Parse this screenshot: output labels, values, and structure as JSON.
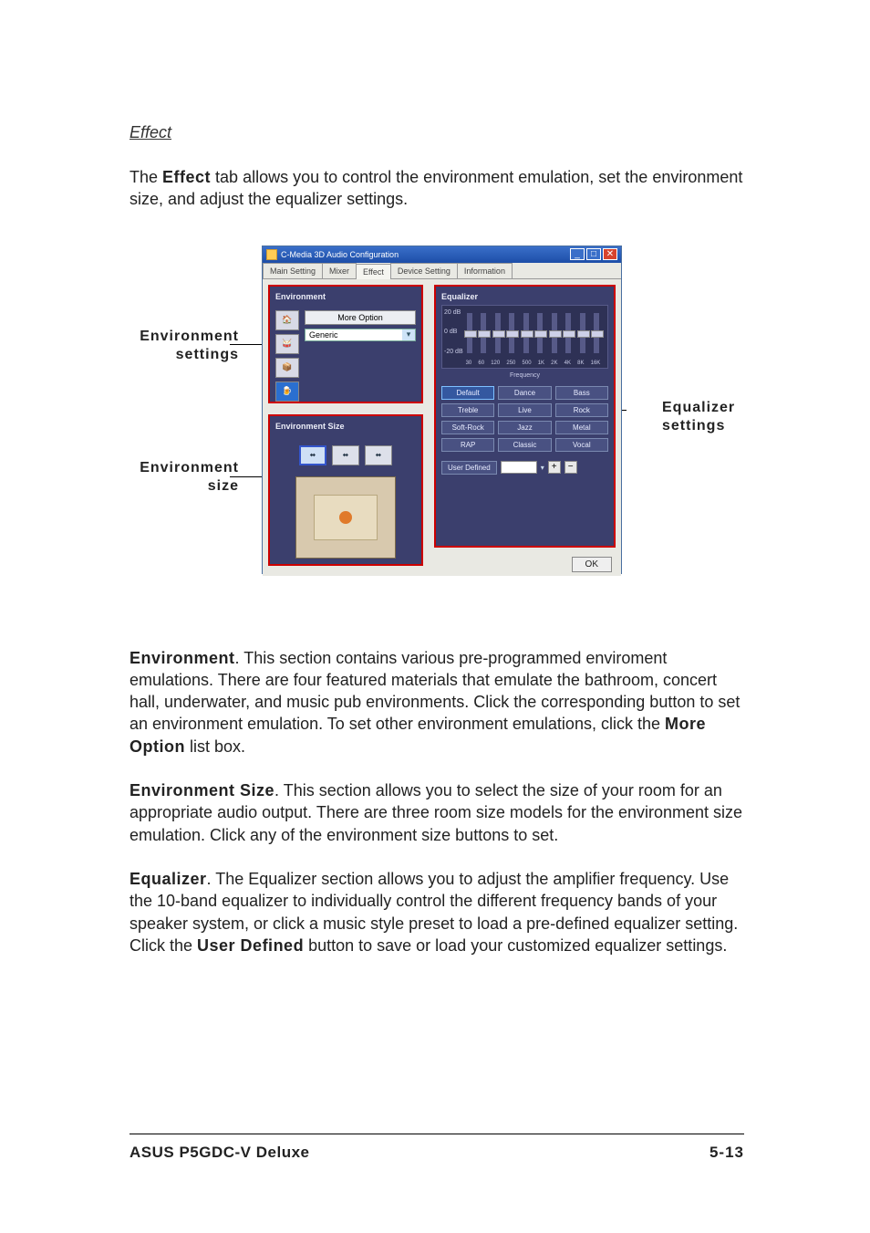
{
  "heading": "Effect",
  "intro_prefix": "The ",
  "intro_bold": "Effect",
  "intro_suffix": " tab allows you to control the environment emulation, set the environment size, and adjust the equalizer settings.",
  "callouts": {
    "env_settings": "Environment\nsettings",
    "env_size": "Environment\nsize",
    "eq_settings": "Equalizer\nsettings"
  },
  "window": {
    "title": "C-Media 3D Audio Configuration",
    "tabs": [
      "Main Setting",
      "Mixer",
      "Effect",
      "Device Setting",
      "Information"
    ],
    "active_tab_index": 2,
    "env_label": "Environment",
    "more_option": "More Option",
    "env_dropdown": "Generic",
    "env_size_label": "Environment Size",
    "eq_label": "Equalizer",
    "eq_y": [
      "20 dB",
      "0 dB",
      "-20 dB"
    ],
    "eq_bands": [
      "30",
      "60",
      "120",
      "250",
      "500",
      "1K",
      "2K",
      "4K",
      "8K",
      "16K"
    ],
    "eq_xaxis": "Frequency",
    "presets": [
      "Default",
      "Dance",
      "Bass",
      "Treble",
      "Live",
      "Rock",
      "Soft-Rock",
      "Jazz",
      "Metal",
      "RAP",
      "Classic",
      "Vocal"
    ],
    "preset_selected_index": 0,
    "user_defined": "User  Defined",
    "ok": "OK"
  },
  "para_env_bold": "Environment",
  "para_env_text": ". This section contains various pre-programmed enviroment emulations. There are four featured materials that emulate the bathroom, concert hall, underwater, and music pub environments. Click the corresponding button to set an environment emulation. To set other environment emulations, click the ",
  "para_env_bold2": "More Option",
  "para_env_text2": " list box.",
  "para_envsize_bold": "Environment Size",
  "para_envsize_text": ". This section allows you to select the size of your room for an appropriate audio output. There are three room size models for the environment size emulation. Click any of the environment size buttons to set.",
  "para_eq_bold": "Equalizer",
  "para_eq_text": ". The Equalizer section allows you to adjust the amplifier frequency. Use the 10-band equalizer to individually control the different frequency bands of your speaker system, or click a music style preset to load a pre-defined equalizer setting. Click the ",
  "para_eq_bold2": "User Defined",
  "para_eq_text2": " button to save or load your customized equalizer settings.",
  "footer_product": "ASUS P5GDC-V Deluxe",
  "footer_page": "5-13"
}
